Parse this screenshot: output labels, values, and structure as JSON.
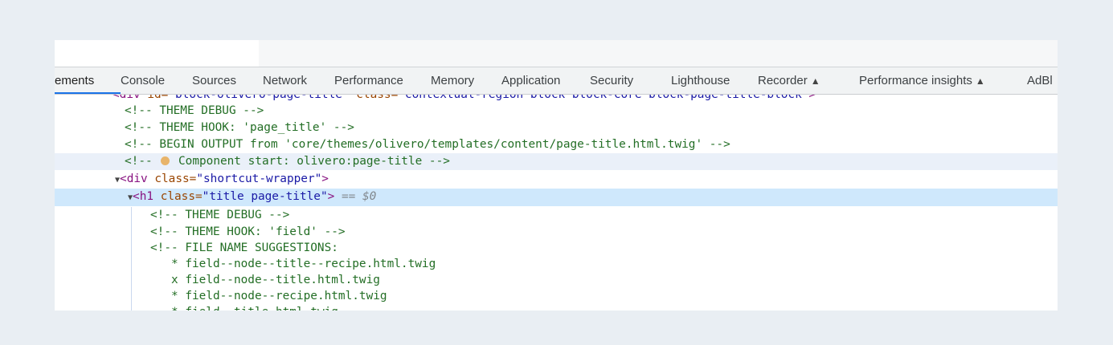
{
  "tabs": [
    {
      "label": "ements",
      "active": true
    },
    {
      "label": "Console"
    },
    {
      "label": "Sources"
    },
    {
      "label": "Network"
    },
    {
      "label": "Performance"
    },
    {
      "label": "Memory"
    },
    {
      "label": "Application"
    },
    {
      "label": "Security"
    },
    {
      "label": "Lighthouse"
    },
    {
      "label": "Recorder",
      "experimental": true
    },
    {
      "label": "Performance insights",
      "experimental": true
    },
    {
      "label": "AdBl"
    }
  ],
  "icons": {
    "experimental": "flask-icon",
    "expand": "triangle-down-icon"
  },
  "colors": {
    "comment": "#236e25",
    "tag": "#881280",
    "attr_name": "#994500",
    "attr_value": "#1a1aa6",
    "selected_row": "#cfe8fc",
    "active_tab_underline": "#1a73e8"
  },
  "code": {
    "r0": {
      "open": "<div ",
      "a1": "id=",
      "v1": "\"block-olivero-page-title\"",
      "a2": " class=",
      "v2": "\"contextual-region block block-core block-page-title-block\"",
      "close": ">"
    },
    "r1": "<!-- THEME DEBUG -->",
    "r2": "<!-- THEME HOOK: 'page_title' -->",
    "r3": "<!-- BEGIN OUTPUT from 'core/themes/olivero/templates/content/page-title.html.twig' -->",
    "r4a": "<!--",
    "r4b": "Component start: olivero:page-title -->",
    "r5": {
      "open": "<div ",
      "attr": "class=",
      "val": "\"shortcut-wrapper\"",
      "close": ">"
    },
    "r6": {
      "open": "<h1 ",
      "attr": "class=",
      "val": "\"title page-title\"",
      "close": ">",
      "ref": " == $0"
    },
    "r7": "<!-- THEME DEBUG -->",
    "r8": "<!-- THEME HOOK: 'field' -->",
    "r9": "<!-- FILE NAME SUGGESTIONS:",
    "r10": "* field--node--title--recipe.html.twig",
    "r11": "x field--node--title.html.twig",
    "r12": "* field--node--recipe.html.twig",
    "r13": "* field--title.html.twig"
  }
}
